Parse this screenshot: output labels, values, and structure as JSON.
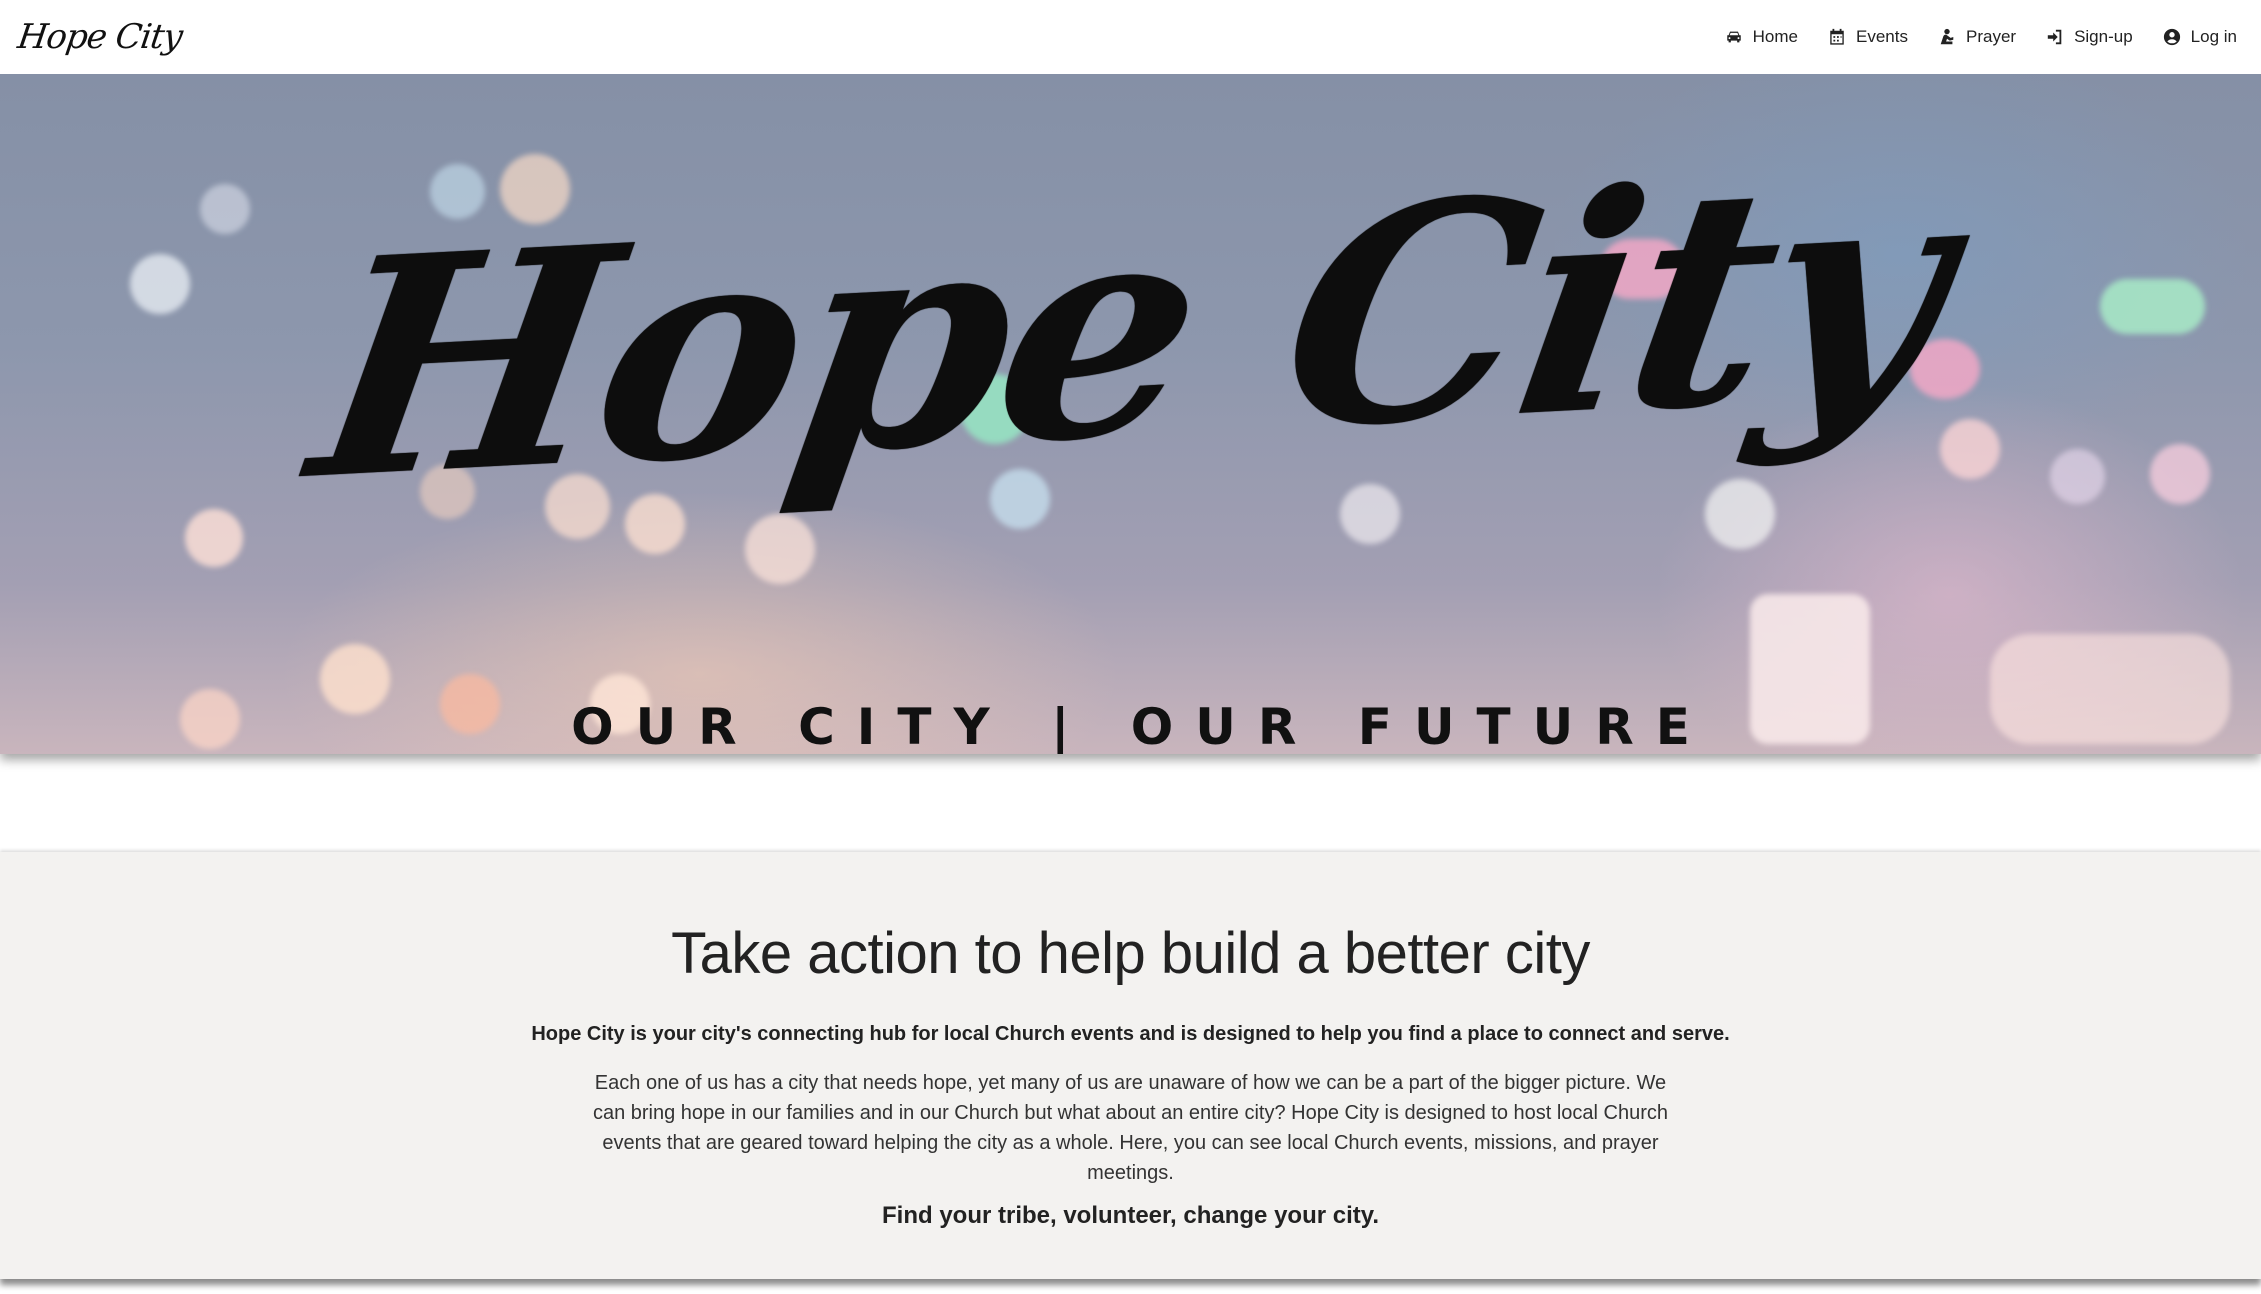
{
  "navbar": {
    "brand": "Hope City",
    "items": [
      {
        "label": "Home",
        "icon": "car-icon"
      },
      {
        "label": "Events",
        "icon": "calendar-icon"
      },
      {
        "label": "Prayer",
        "icon": "praying-hands-icon"
      },
      {
        "label": "Sign-up",
        "icon": "sign-in-icon"
      },
      {
        "label": "Log in",
        "icon": "user-circle-icon"
      }
    ]
  },
  "hero": {
    "title": "Hope City",
    "tagline": "OUR CITY | OUR FUTURE"
  },
  "about": {
    "heading": "Take action to help build a better city",
    "lead": "Hope City is your city's connecting hub for local Church events and is designed to help you find a place to connect and serve.",
    "body": "Each one of us has a city that needs hope, yet many of us are unaware of how we can be a part of the bigger picture. We can bring hope in our families and in our Church but what about an entire city? Hope City is designed to host local Church events that are geared toward helping the city as a whole. Here, you can see local Church events, missions, and prayer meetings.",
    "cta": "Find your tribe, volunteer, change your city."
  }
}
